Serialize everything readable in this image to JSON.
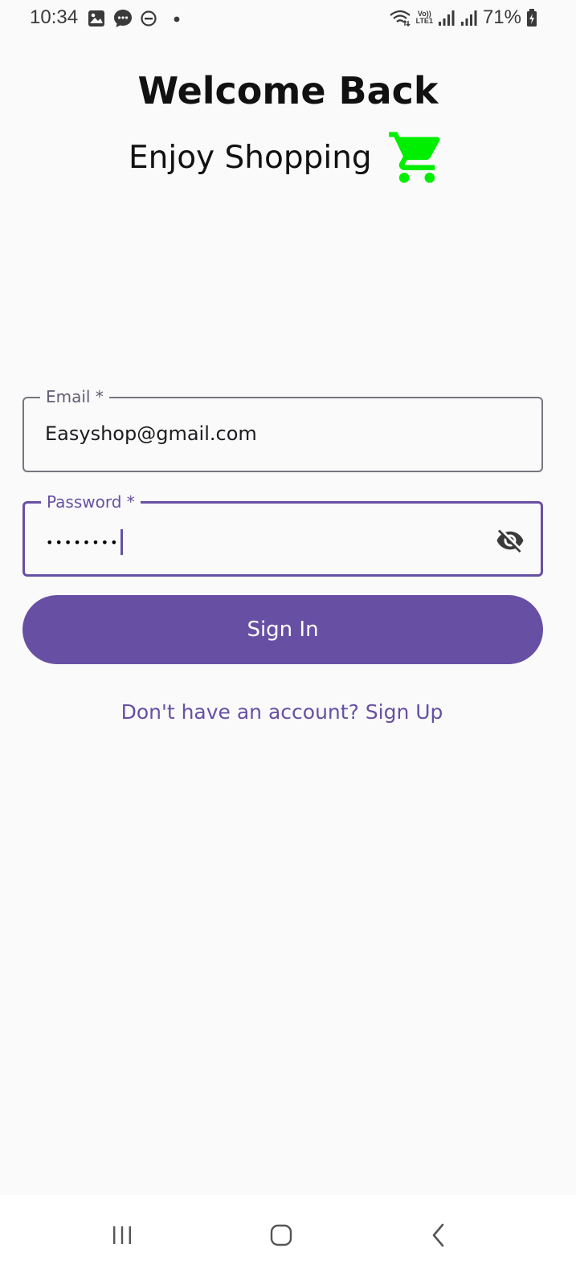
{
  "status_bar": {
    "time": "10:34",
    "battery_text": "71%",
    "network_label_top": "Vo))",
    "network_label_bottom": "LTE1",
    "icons": [
      "gallery-icon",
      "chat-bubble-icon",
      "do-not-disturb-icon",
      "dot-icon",
      "wifi-icon",
      "signal-icon",
      "signal-icon",
      "battery-charging-icon"
    ]
  },
  "header": {
    "title": "Welcome Back",
    "subtitle": "Enjoy Shopping",
    "cart_icon": "shopping-cart-icon",
    "cart_color": "#00ee00"
  },
  "form": {
    "email": {
      "label": "Email *",
      "value": "Easyshop@gmail.com"
    },
    "password": {
      "label": "Password *",
      "value": "••••••••",
      "visibility_icon": "eye-off-icon"
    },
    "sign_in_label": "Sign In",
    "sign_up_link": "Don't have an account? Sign Up"
  },
  "theme": {
    "primary": "#6750a4",
    "background": "#fafafa"
  },
  "nav_bar": {
    "icons": [
      "recent-apps-icon",
      "home-icon",
      "back-icon"
    ]
  }
}
